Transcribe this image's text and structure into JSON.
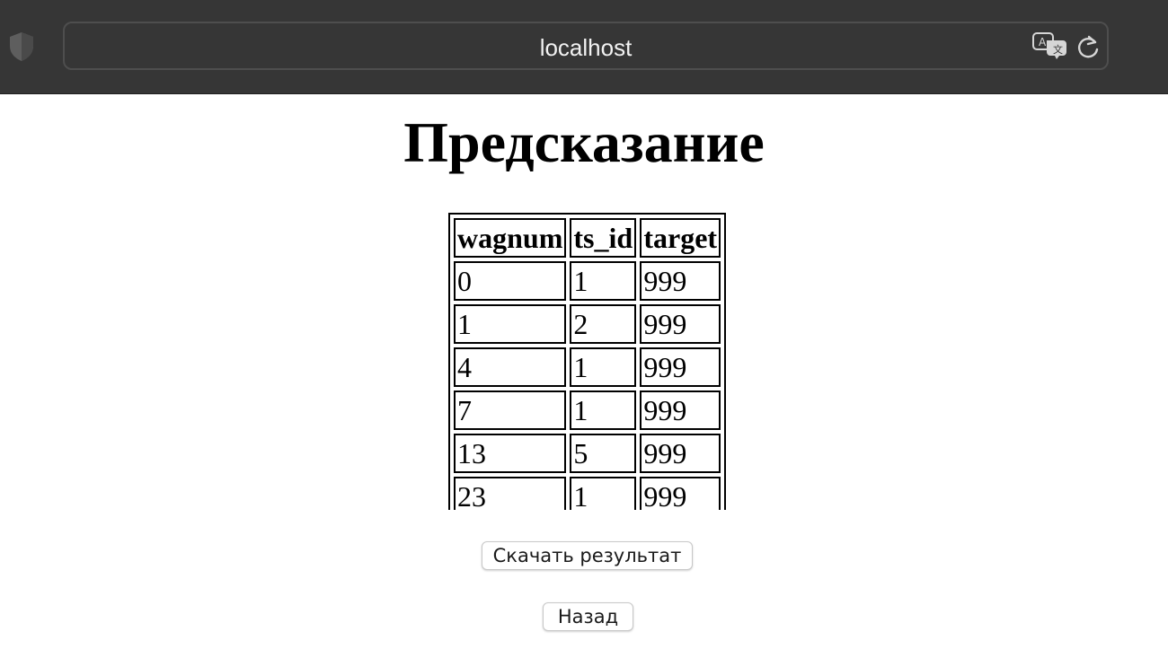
{
  "browser": {
    "url": "localhost",
    "icons": {
      "shield": "shield-icon",
      "translate": "translate-icon",
      "reload": "reload-icon"
    }
  },
  "page": {
    "title": "Предсказание",
    "table": {
      "headers": [
        "wagnum",
        "ts_id",
        "target"
      ],
      "rows": [
        [
          "0",
          "1",
          "999"
        ],
        [
          "1",
          "2",
          "999"
        ],
        [
          "4",
          "1",
          "999"
        ],
        [
          "7",
          "1",
          "999"
        ],
        [
          "13",
          "5",
          "999"
        ],
        [
          "23",
          "1",
          "999"
        ]
      ]
    },
    "buttons": {
      "download": "Скачать результат",
      "back": "Назад"
    }
  }
}
